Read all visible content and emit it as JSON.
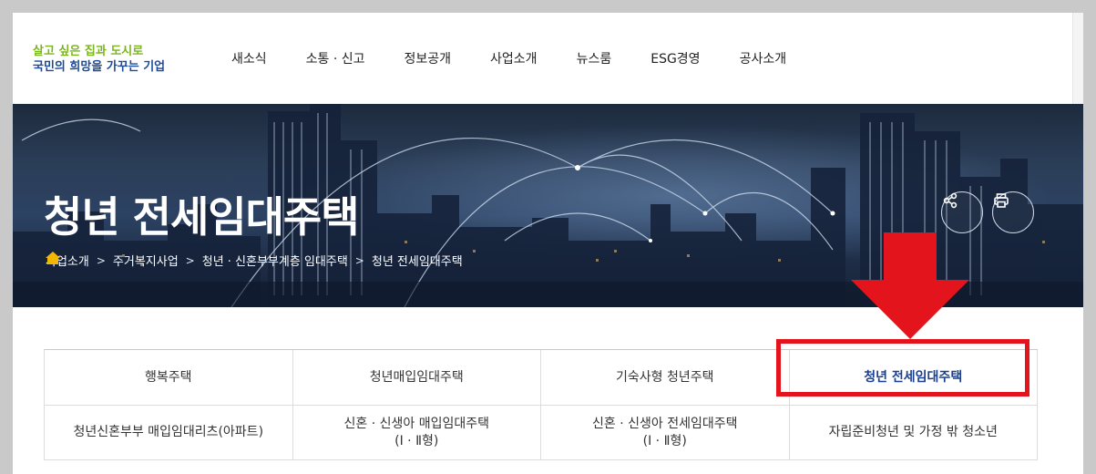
{
  "logo": {
    "line1": "살고 싶은 집과 도시로",
    "line2": "국민의 희망을 가꾸는 기업"
  },
  "gnb": [
    "새소식",
    "소통 · 신고",
    "정보공개",
    "사업소개",
    "뉴스룸",
    "ESG경영",
    "공사소개"
  ],
  "banner": {
    "title": "청년 전세임대주택",
    "breadcrumb": [
      "사업소개",
      "주거복지사업",
      "청년 · 신혼부부계층 임대주택",
      "청년 전세임대주택"
    ]
  },
  "tabs": {
    "row1": [
      "행복주택",
      "청년매입임대주택",
      "기숙사형 청년주택",
      "청년 전세임대주택"
    ],
    "row2": [
      [
        "청년신혼부부 매입임대리츠(아파트)",
        ""
      ],
      [
        "신혼 · 신생아 매입임대주택",
        "(Ⅰ · Ⅱ형)"
      ],
      [
        "신혼 · 신생아 전세임대주택",
        "(Ⅰ · Ⅱ형)"
      ],
      [
        "자립준비청년 및 가정 밖 청소년",
        ""
      ]
    ],
    "active": "청년 전세임대주택"
  },
  "colors": {
    "logo_green": "#7ab51d",
    "logo_blue": "#1b4a9a",
    "active_tab": "#1b3f8f",
    "annotation_red": "#e3141c"
  },
  "icons": [
    "home-icon",
    "share-icon",
    "print-icon",
    "chevron-right-icon"
  ]
}
